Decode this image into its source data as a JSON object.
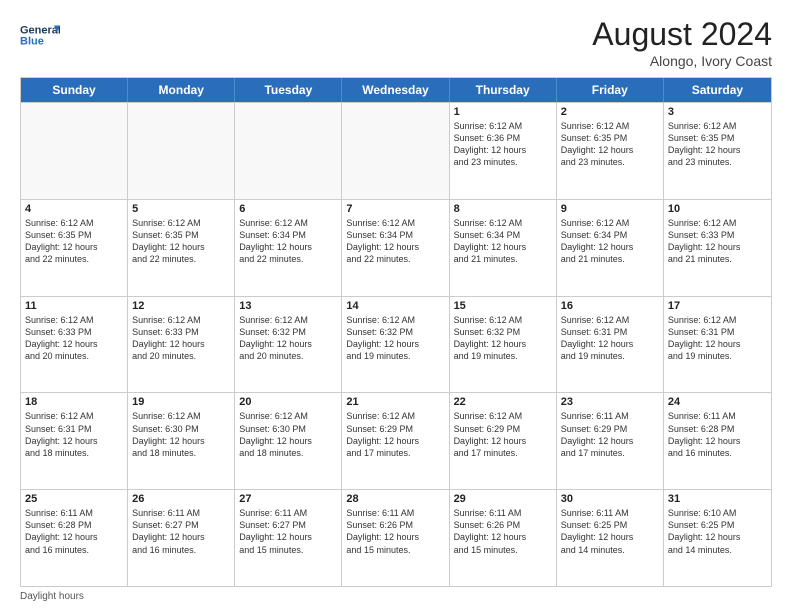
{
  "header": {
    "logo_line1": "General",
    "logo_line2": "Blue",
    "month_year": "August 2024",
    "location": "Alongo, Ivory Coast"
  },
  "days_of_week": [
    "Sunday",
    "Monday",
    "Tuesday",
    "Wednesday",
    "Thursday",
    "Friday",
    "Saturday"
  ],
  "weeks": [
    [
      {
        "day": "",
        "info": ""
      },
      {
        "day": "",
        "info": ""
      },
      {
        "day": "",
        "info": ""
      },
      {
        "day": "",
        "info": ""
      },
      {
        "day": "1",
        "info": "Sunrise: 6:12 AM\nSunset: 6:36 PM\nDaylight: 12 hours\nand 23 minutes."
      },
      {
        "day": "2",
        "info": "Sunrise: 6:12 AM\nSunset: 6:35 PM\nDaylight: 12 hours\nand 23 minutes."
      },
      {
        "day": "3",
        "info": "Sunrise: 6:12 AM\nSunset: 6:35 PM\nDaylight: 12 hours\nand 23 minutes."
      }
    ],
    [
      {
        "day": "4",
        "info": "Sunrise: 6:12 AM\nSunset: 6:35 PM\nDaylight: 12 hours\nand 22 minutes."
      },
      {
        "day": "5",
        "info": "Sunrise: 6:12 AM\nSunset: 6:35 PM\nDaylight: 12 hours\nand 22 minutes."
      },
      {
        "day": "6",
        "info": "Sunrise: 6:12 AM\nSunset: 6:34 PM\nDaylight: 12 hours\nand 22 minutes."
      },
      {
        "day": "7",
        "info": "Sunrise: 6:12 AM\nSunset: 6:34 PM\nDaylight: 12 hours\nand 22 minutes."
      },
      {
        "day": "8",
        "info": "Sunrise: 6:12 AM\nSunset: 6:34 PM\nDaylight: 12 hours\nand 21 minutes."
      },
      {
        "day": "9",
        "info": "Sunrise: 6:12 AM\nSunset: 6:34 PM\nDaylight: 12 hours\nand 21 minutes."
      },
      {
        "day": "10",
        "info": "Sunrise: 6:12 AM\nSunset: 6:33 PM\nDaylight: 12 hours\nand 21 minutes."
      }
    ],
    [
      {
        "day": "11",
        "info": "Sunrise: 6:12 AM\nSunset: 6:33 PM\nDaylight: 12 hours\nand 20 minutes."
      },
      {
        "day": "12",
        "info": "Sunrise: 6:12 AM\nSunset: 6:33 PM\nDaylight: 12 hours\nand 20 minutes."
      },
      {
        "day": "13",
        "info": "Sunrise: 6:12 AM\nSunset: 6:32 PM\nDaylight: 12 hours\nand 20 minutes."
      },
      {
        "day": "14",
        "info": "Sunrise: 6:12 AM\nSunset: 6:32 PM\nDaylight: 12 hours\nand 19 minutes."
      },
      {
        "day": "15",
        "info": "Sunrise: 6:12 AM\nSunset: 6:32 PM\nDaylight: 12 hours\nand 19 minutes."
      },
      {
        "day": "16",
        "info": "Sunrise: 6:12 AM\nSunset: 6:31 PM\nDaylight: 12 hours\nand 19 minutes."
      },
      {
        "day": "17",
        "info": "Sunrise: 6:12 AM\nSunset: 6:31 PM\nDaylight: 12 hours\nand 19 minutes."
      }
    ],
    [
      {
        "day": "18",
        "info": "Sunrise: 6:12 AM\nSunset: 6:31 PM\nDaylight: 12 hours\nand 18 minutes."
      },
      {
        "day": "19",
        "info": "Sunrise: 6:12 AM\nSunset: 6:30 PM\nDaylight: 12 hours\nand 18 minutes."
      },
      {
        "day": "20",
        "info": "Sunrise: 6:12 AM\nSunset: 6:30 PM\nDaylight: 12 hours\nand 18 minutes."
      },
      {
        "day": "21",
        "info": "Sunrise: 6:12 AM\nSunset: 6:29 PM\nDaylight: 12 hours\nand 17 minutes."
      },
      {
        "day": "22",
        "info": "Sunrise: 6:12 AM\nSunset: 6:29 PM\nDaylight: 12 hours\nand 17 minutes."
      },
      {
        "day": "23",
        "info": "Sunrise: 6:11 AM\nSunset: 6:29 PM\nDaylight: 12 hours\nand 17 minutes."
      },
      {
        "day": "24",
        "info": "Sunrise: 6:11 AM\nSunset: 6:28 PM\nDaylight: 12 hours\nand 16 minutes."
      }
    ],
    [
      {
        "day": "25",
        "info": "Sunrise: 6:11 AM\nSunset: 6:28 PM\nDaylight: 12 hours\nand 16 minutes."
      },
      {
        "day": "26",
        "info": "Sunrise: 6:11 AM\nSunset: 6:27 PM\nDaylight: 12 hours\nand 16 minutes."
      },
      {
        "day": "27",
        "info": "Sunrise: 6:11 AM\nSunset: 6:27 PM\nDaylight: 12 hours\nand 15 minutes."
      },
      {
        "day": "28",
        "info": "Sunrise: 6:11 AM\nSunset: 6:26 PM\nDaylight: 12 hours\nand 15 minutes."
      },
      {
        "day": "29",
        "info": "Sunrise: 6:11 AM\nSunset: 6:26 PM\nDaylight: 12 hours\nand 15 minutes."
      },
      {
        "day": "30",
        "info": "Sunrise: 6:11 AM\nSunset: 6:25 PM\nDaylight: 12 hours\nand 14 minutes."
      },
      {
        "day": "31",
        "info": "Sunrise: 6:10 AM\nSunset: 6:25 PM\nDaylight: 12 hours\nand 14 minutes."
      }
    ]
  ],
  "footer": "Daylight hours"
}
